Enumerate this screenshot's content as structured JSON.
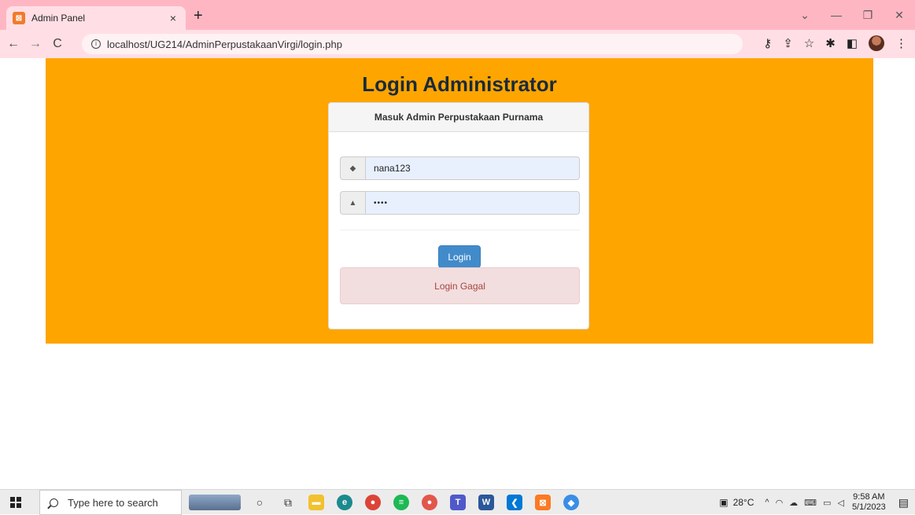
{
  "browser": {
    "tab_title": "Admin Panel",
    "tab_close": "×",
    "new_tab": "+",
    "url": "localhost/UG214/AdminPerpustakaanVirgi/login.php",
    "window_controls": [
      "⌄",
      "—",
      "❐",
      "✕"
    ],
    "nav": {
      "back": "←",
      "forward": "→",
      "reload": "C"
    }
  },
  "page": {
    "heading": "Login Administrator",
    "panel_title": "Masuk Admin Perpustakaan Purnama",
    "username_value": "nana123",
    "password_value": "••••",
    "login_button": "Login",
    "error_message": "Login Gagal",
    "colors": {
      "banner": "#ffa500",
      "button": "#428bca",
      "alert_bg": "#f2dede",
      "alert_text": "#a94442"
    }
  },
  "taskbar": {
    "search_placeholder": "Type here to search",
    "temperature": "28°C",
    "time": "9:58 AM",
    "date": "5/1/2023",
    "apps": [
      "cortana-icon",
      "task-view-icon",
      "file-explorer-icon",
      "edge-icon",
      "chrome-icon",
      "spotify-icon",
      "chrome-profile-icon",
      "teams-icon",
      "word-icon",
      "vscode-icon",
      "xampp-icon",
      "app-icon"
    ]
  }
}
